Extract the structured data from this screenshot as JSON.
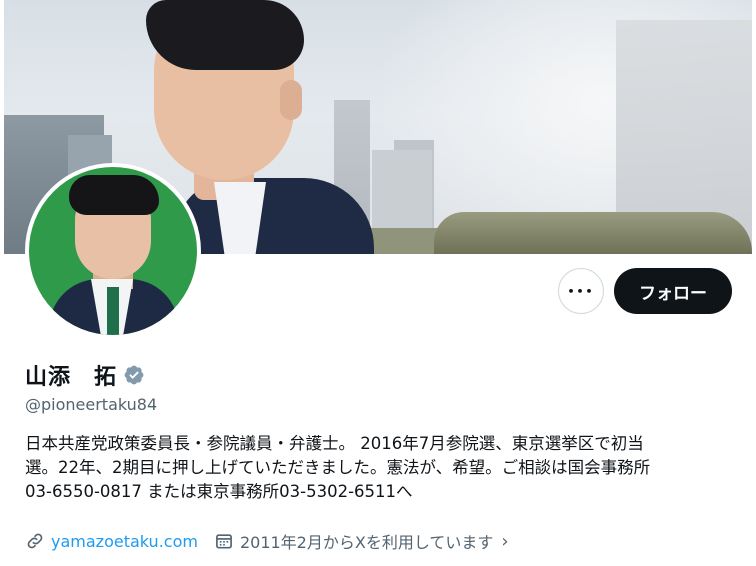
{
  "profile": {
    "name": "山添　拓",
    "handle": "@pioneertaku84",
    "bio_lines": [
      "日本共産党政策委員長・参院議員・弁護士。 2016年7月参院選、東京選挙区で初当",
      "選。22年、2期目に押し上げていただきました。憲法が、希望。ご相談は国会事務所",
      "03-6550-0817 または東京事務所03-5302-6511へ"
    ],
    "website": "yamazoetaku.com",
    "joined": "2011年2月からXを利用しています",
    "verified_icon": "verified-badge-icon"
  },
  "actions": {
    "more_label": "•••",
    "follow_label": "フォロー"
  },
  "colors": {
    "follow_bg": "#0f1419",
    "link": "#1d9bf0",
    "muted": "#536471",
    "avatar_bg": "#2f9a4a"
  }
}
